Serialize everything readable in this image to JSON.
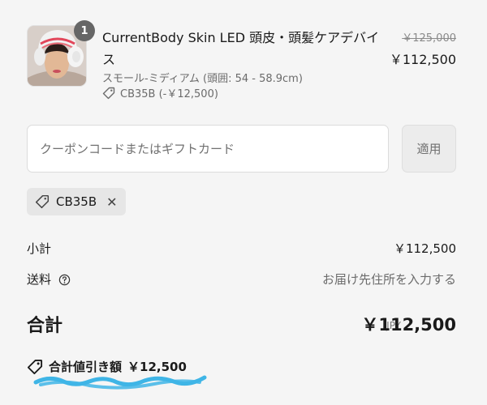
{
  "product": {
    "quantity": "1",
    "title": "CurrentBody Skin LED 頭皮・頭髪ケアデバイス",
    "variant": "スモール-ミディアム (頭囲: 54 - 58.9cm)",
    "discount_code_label": "CB35B (-￥12,500)",
    "price_original": "￥125,000",
    "price_current": "￥112,500",
    "thumbnail_icon": "product-photo"
  },
  "coupon": {
    "placeholder": "クーポンコードまたはギフトカード",
    "value": "",
    "apply_label": "適用",
    "applied_code": "CB35B"
  },
  "summary": {
    "subtotal_label": "小計",
    "subtotal_value": "￥112,500",
    "shipping_label": "送料",
    "shipping_value": "お届け先住所を入力する",
    "total_label": "合計",
    "currency": "JPY",
    "total_value": "￥112,500",
    "savings_label": "合計値引き額",
    "savings_value": "￥12,500"
  },
  "colors": {
    "background": "#f5f5f5",
    "annotation_scribble": "#3fb5e6"
  }
}
